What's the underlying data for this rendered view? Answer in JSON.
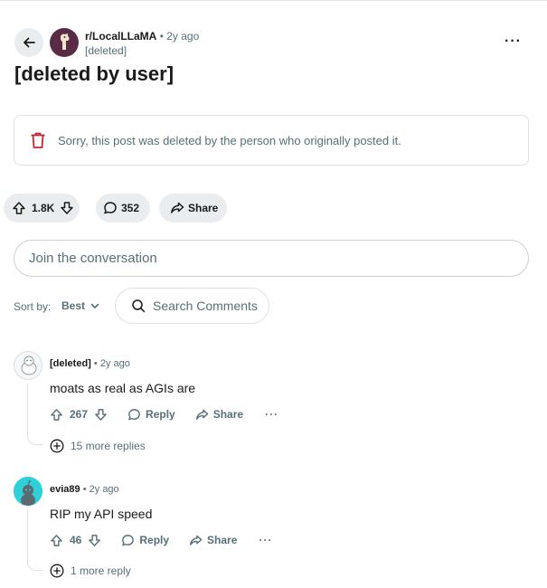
{
  "post": {
    "subreddit": "r/LocalLLaMA",
    "time_ago": "2y ago",
    "separator": "•",
    "author": "[deleted]",
    "title": "[deleted by user]",
    "more_label": "···",
    "notice": "Sorry, this post was deleted by the person who originally posted it.",
    "votes": "1.8K",
    "comments_count": "352",
    "share_label": "Share"
  },
  "join": {
    "placeholder": "Join the conversation"
  },
  "sort": {
    "label": "Sort by:",
    "value": "Best"
  },
  "search": {
    "placeholder": "Search Comments"
  },
  "comments": [
    {
      "author": "[deleted]",
      "time_ago": "2y ago",
      "body": "moats as real as AGIs are",
      "votes": "267",
      "reply_label": "Reply",
      "share_label": "Share",
      "more_label": "···",
      "more_replies": "15 more replies"
    },
    {
      "author": "evia89",
      "time_ago": "2y ago",
      "body": "RIP my API speed",
      "votes": "46",
      "reply_label": "Reply",
      "share_label": "Share",
      "more_label": "···",
      "more_replies": "1 more reply"
    }
  ],
  "icons": {
    "back": "arrow-left-icon",
    "upvote": "arrow-up-icon",
    "downvote": "arrow-down-icon",
    "comment": "speech-bubble-icon",
    "share": "share-arrow-icon",
    "trash": "trash-icon",
    "search": "search-icon",
    "chevron": "chevron-down-icon",
    "expand": "plus-circle-icon"
  },
  "colors": {
    "pill_bg": "#eaedef",
    "muted_text": "#576f76",
    "trash_red": "#c0282d",
    "subreddit_avatar": "#5a2b45",
    "evia_avatar": "#2fd0d8"
  }
}
